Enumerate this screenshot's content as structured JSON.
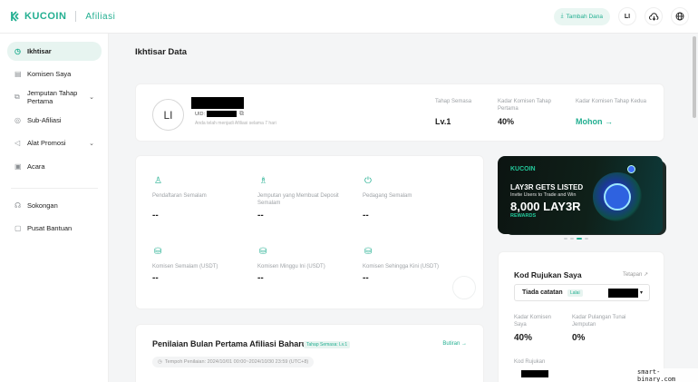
{
  "header": {
    "brand": "KUCOIN",
    "subtitle": "Afiliasi",
    "add_button": "Tambah Dana",
    "user_initials": "LI"
  },
  "sidebar": {
    "items": [
      {
        "label": "Ikhtisar",
        "icon": "dashboard-icon",
        "active": true
      },
      {
        "label": "Komisen Saya",
        "icon": "wallet-icon"
      },
      {
        "label": "Jemputan Tahap Pertama",
        "icon": "invite-icon",
        "expandable": true
      },
      {
        "label": "Sub-Afiliasi",
        "icon": "network-icon"
      },
      {
        "label": "Alat Promosi",
        "icon": "megaphone-icon",
        "expandable": true
      },
      {
        "label": "Acara",
        "icon": "gift-icon"
      },
      {
        "label": "Sokongan",
        "icon": "headset-icon"
      },
      {
        "label": "Pusat Bantuan",
        "icon": "help-icon"
      }
    ]
  },
  "main": {
    "title": "Ikhtisar Data",
    "profile": {
      "avatar": "LI",
      "uid_label": "UID:",
      "joined_note": "Anda telah menjadi Afiliasi selama 7 hari"
    },
    "stats": [
      {
        "label": "Tahap Semasa",
        "value": "Lv.1"
      },
      {
        "label": "Kadar Komisen Tahap Pertama",
        "value": "40%"
      },
      {
        "label": "Kadar Komisen Tahap Kedua",
        "value": "Mohon →",
        "link": true
      }
    ],
    "metrics": [
      {
        "label": "Pendaftaran Semalam",
        "value": "--",
        "icon": "user-icon"
      },
      {
        "label": "Jemputan yang Membuat Deposit Semalam",
        "value": "--",
        "icon": "deposit-user-icon"
      },
      {
        "label": "Pedagang Semalam",
        "value": "--",
        "icon": "trade-icon"
      },
      {
        "label": "Komisen Semalam (USDT)",
        "value": "--",
        "icon": "commission-icon"
      },
      {
        "label": "Komisen Minggu Ini (USDT)",
        "value": "--",
        "icon": "commission-week-icon"
      },
      {
        "label": "Komisen Sehingga Kini (USDT)",
        "value": "--",
        "icon": "commission-total-icon"
      }
    ],
    "banner": {
      "brand": "KUCOIN",
      "headline": "LAY3R GETS LISTED",
      "sub": "Invite Users to Trade and Win",
      "big": "8,000 LAY3R",
      "rewards": "REWARDS"
    },
    "referral": {
      "title": "Kod Rujukan Saya",
      "settings": "Tetapan ↗",
      "selected": "Tiada catatan",
      "badge": "Lalai",
      "rate_label": "Kadar Komisen Saya",
      "rate_value": "40%",
      "cashback_label": "Kadar Pulangan Tunai Jemputan",
      "cashback_value": "0%",
      "code_label": "Kod Rujukan"
    },
    "assessment": {
      "title": "Penilaian Bulan Pertama Afiliasi Baharu",
      "badge": "Tahap Semasa: Lv.1",
      "link": "Butiran →",
      "period": "Tempoh Penilaian: 2024/10/01 00:00~2024/10/30 23:59 (UTC+8)"
    }
  },
  "watermark": "smart-binary.com",
  "colors": {
    "accent": "#23af91",
    "background": "#f4f5f6"
  }
}
